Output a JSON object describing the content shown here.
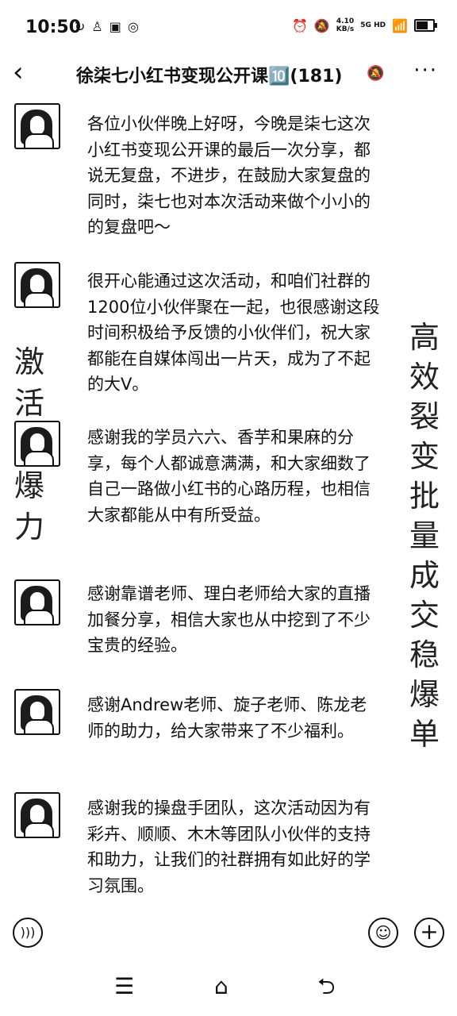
{
  "status_bar": {
    "time": "10:50",
    "left_icons": [
      "sync-icon",
      "person-icon",
      "app-icon",
      "location-icon"
    ],
    "speed_value": "4.10",
    "speed_unit": "KB/s",
    "network": "5G HD",
    "battery_level": 0.8
  },
  "header": {
    "title": "徐柒七小红书变现公开课🔟(181)",
    "back_icon": "‹",
    "more_icon": "···",
    "mute_icon": "🔕"
  },
  "messages": [
    {
      "text": "各位小伙伴晚上好呀，今晚是柒七这次小红书变现公开课的最后一次分享，都说无复盘，不进步，在鼓励大家复盘的同时，柒七也对本次活动来做个小小的的复盘吧～"
    },
    {
      "text": "很开心能通过这次活动，和咱们社群的1200位小伙伴聚在一起，也很感谢这段时间积极给予反馈的小伙伴们，祝大家都能在自媒体闯出一片天，成为了不起的大V。"
    },
    {
      "text": "感谢我的学员六六、香芋和果麻的分享，每个人都诚意满满，和大家细数了自己一路做小红书的心路历程，也相信大家都能从中有所受益。"
    },
    {
      "text": "感谢靠谱老师、理白老师给大家的直播加餐分享，相信大家也从中挖到了不少宝贵的经验。"
    },
    {
      "text": "感谢Andrew老师、旋子老师、陈龙老师的助力，给大家带来了不少福利。"
    },
    {
      "text": "感谢我的操盘手团队，这次活动因为有彩卉、顺顺、木木等团队小伙伴的支持和助力，让我们的社群拥有如此好的学习氛围。"
    }
  ],
  "watermark": {
    "left": "激活 打爆 力",
    "right": "高效裂变 批量成交稳爆单"
  },
  "input_bar": {
    "voice_icon": "voice-icon",
    "emoji_icon": "emoji-icon",
    "plus_icon": "plus-icon"
  },
  "nav_bar": {
    "menu_glyph": "☰",
    "home_glyph": "⌂",
    "back_glyph": "⮌"
  }
}
